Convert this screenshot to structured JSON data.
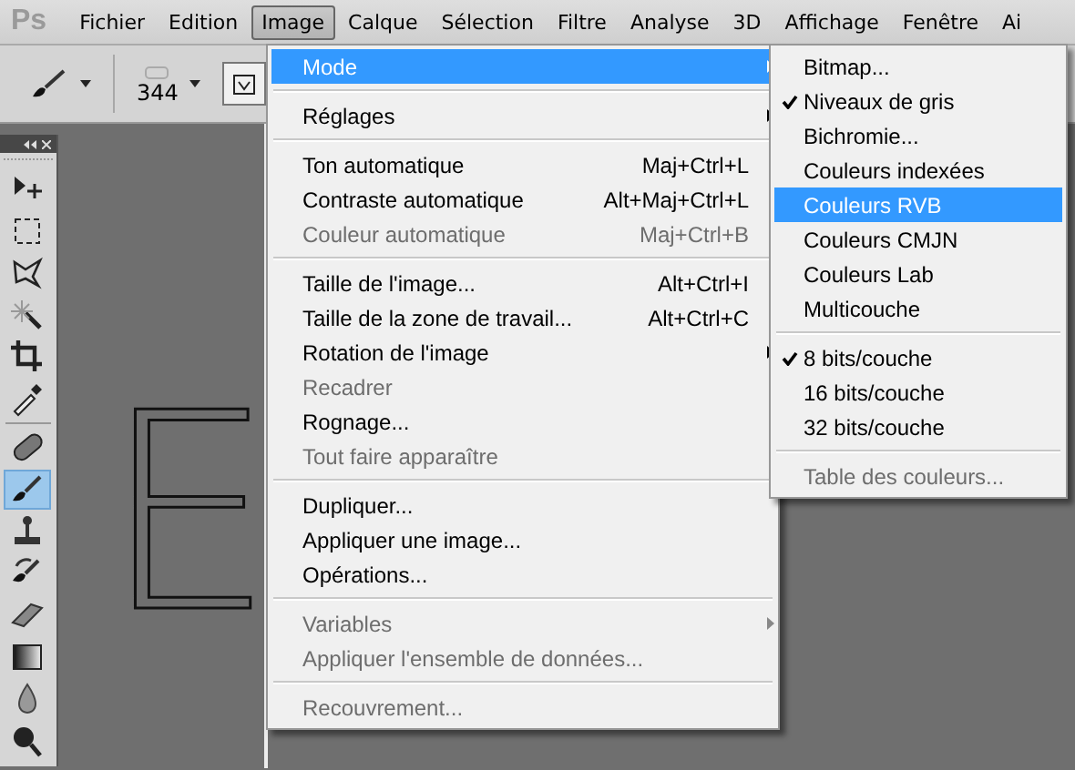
{
  "menubar": {
    "logo": "Ps",
    "items": [
      {
        "label": "Fichier",
        "selected": false
      },
      {
        "label": "Edition",
        "selected": false
      },
      {
        "label": "Image",
        "selected": true
      },
      {
        "label": "Calque",
        "selected": false
      },
      {
        "label": "Sélection",
        "selected": false
      },
      {
        "label": "Filtre",
        "selected": false
      },
      {
        "label": "Analyse",
        "selected": false
      },
      {
        "label": "3D",
        "selected": false
      },
      {
        "label": "Affichage",
        "selected": false
      },
      {
        "label": "Fenêtre",
        "selected": false
      },
      {
        "label": "Ai",
        "selected": false
      }
    ]
  },
  "options_bar": {
    "brush_size": "344"
  },
  "tools": [
    {
      "kind": "move",
      "selected": false
    },
    {
      "kind": "marquee",
      "selected": false
    },
    {
      "kind": "lasso",
      "selected": false
    },
    {
      "kind": "wand",
      "selected": false
    },
    {
      "kind": "crop",
      "selected": false
    },
    {
      "kind": "eyedropper",
      "selected": false
    },
    {
      "kind": "separator"
    },
    {
      "kind": "heal",
      "selected": false
    },
    {
      "kind": "brush",
      "selected": true
    },
    {
      "kind": "stamp",
      "selected": false
    },
    {
      "kind": "history",
      "selected": false
    },
    {
      "kind": "eraser",
      "selected": false
    },
    {
      "kind": "gradient",
      "selected": false
    },
    {
      "kind": "blur",
      "selected": false
    },
    {
      "kind": "dodge",
      "selected": false
    }
  ],
  "canvas_text": "E",
  "image_menu": [
    {
      "kind": "item",
      "label": "Mode",
      "submenu": true,
      "disabled": false,
      "selected": true
    },
    {
      "kind": "separator"
    },
    {
      "kind": "item",
      "label": "Réglages",
      "submenu": true,
      "disabled": false,
      "selected": false
    },
    {
      "kind": "separator"
    },
    {
      "kind": "item",
      "label": "Ton automatique",
      "shortcut": "Maj+Ctrl+L",
      "disabled": false,
      "selected": false
    },
    {
      "kind": "item",
      "label": "Contraste automatique",
      "shortcut": "Alt+Maj+Ctrl+L",
      "disabled": false,
      "selected": false
    },
    {
      "kind": "item",
      "label": "Couleur automatique",
      "shortcut": "Maj+Ctrl+B",
      "disabled": true,
      "selected": false
    },
    {
      "kind": "separator"
    },
    {
      "kind": "item",
      "label": "Taille de l'image...",
      "shortcut": "Alt+Ctrl+I",
      "disabled": false,
      "selected": false
    },
    {
      "kind": "item",
      "label": "Taille de la zone de travail...",
      "shortcut": "Alt+Ctrl+C",
      "disabled": false,
      "selected": false
    },
    {
      "kind": "item",
      "label": "Rotation de l'image",
      "submenu": true,
      "disabled": false,
      "selected": false
    },
    {
      "kind": "item",
      "label": "Recadrer",
      "disabled": true,
      "selected": false
    },
    {
      "kind": "item",
      "label": "Rognage...",
      "disabled": false,
      "selected": false
    },
    {
      "kind": "item",
      "label": "Tout faire apparaître",
      "disabled": true,
      "selected": false
    },
    {
      "kind": "separator"
    },
    {
      "kind": "item",
      "label": "Dupliquer...",
      "disabled": false,
      "selected": false
    },
    {
      "kind": "item",
      "label": "Appliquer une image...",
      "disabled": false,
      "selected": false
    },
    {
      "kind": "item",
      "label": "Opérations...",
      "disabled": false,
      "selected": false
    },
    {
      "kind": "separator"
    },
    {
      "kind": "item",
      "label": "Variables",
      "submenu": true,
      "disabled": true,
      "selected": false
    },
    {
      "kind": "item",
      "label": "Appliquer l'ensemble de données...",
      "disabled": true,
      "selected": false
    },
    {
      "kind": "separator"
    },
    {
      "kind": "item",
      "label": "Recouvrement...",
      "disabled": true,
      "selected": false
    }
  ],
  "mode_submenu": [
    {
      "kind": "item",
      "label": "Bitmap...",
      "checked": false,
      "disabled": false,
      "selected": false
    },
    {
      "kind": "item",
      "label": "Niveaux de gris",
      "checked": true,
      "disabled": false,
      "selected": false
    },
    {
      "kind": "item",
      "label": "Bichromie...",
      "checked": false,
      "disabled": false,
      "selected": false
    },
    {
      "kind": "item",
      "label": "Couleurs indexées",
      "checked": false,
      "disabled": false,
      "selected": false
    },
    {
      "kind": "item",
      "label": "Couleurs RVB",
      "checked": false,
      "disabled": false,
      "selected": true
    },
    {
      "kind": "item",
      "label": "Couleurs CMJN",
      "checked": false,
      "disabled": false,
      "selected": false
    },
    {
      "kind": "item",
      "label": "Couleurs Lab",
      "checked": false,
      "disabled": false,
      "selected": false
    },
    {
      "kind": "item",
      "label": "Multicouche",
      "checked": false,
      "disabled": false,
      "selected": false
    },
    {
      "kind": "separator"
    },
    {
      "kind": "item",
      "label": "8 bits/couche",
      "checked": true,
      "disabled": false,
      "selected": false
    },
    {
      "kind": "item",
      "label": "16 bits/couche",
      "checked": false,
      "disabled": false,
      "selected": false
    },
    {
      "kind": "item",
      "label": "32 bits/couche",
      "checked": false,
      "disabled": false,
      "selected": false
    },
    {
      "kind": "separator"
    },
    {
      "kind": "item",
      "label": "Table des couleurs...",
      "checked": false,
      "disabled": true,
      "selected": false
    }
  ]
}
